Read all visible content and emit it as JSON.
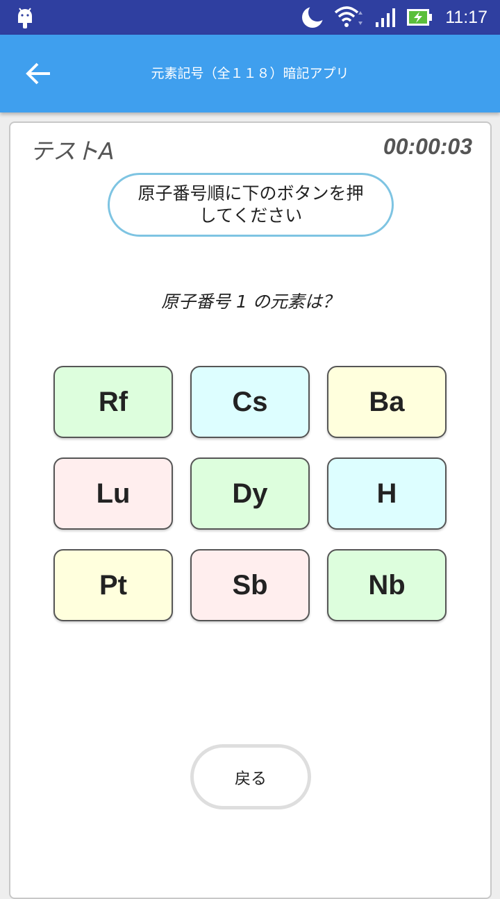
{
  "status_bar": {
    "time": "11:17",
    "icons": [
      "android-icon",
      "moon-icon",
      "wifi-icon",
      "signal-icon",
      "battery-charging-icon"
    ]
  },
  "app_bar": {
    "title": "元素記号（全１１８）暗記アプリ",
    "back_icon": "arrow-left-icon"
  },
  "test": {
    "label": "テストA",
    "timer": "00:00:03",
    "instruction": "原子番号順に下のボタンを押してください",
    "question": "原子番号 1 の元素は？"
  },
  "elements": [
    {
      "symbol": "Rf",
      "color": "#ddfedd"
    },
    {
      "symbol": "Cs",
      "color": "#ddfeff"
    },
    {
      "symbol": "Ba",
      "color": "#ffffdd"
    },
    {
      "symbol": "Lu",
      "color": "#ffeeee"
    },
    {
      "symbol": "Dy",
      "color": "#ddfedd"
    },
    {
      "symbol": "H",
      "color": "#ddfeff"
    },
    {
      "symbol": "Pt",
      "color": "#ffffdd"
    },
    {
      "symbol": "Sb",
      "color": "#ffeeee"
    },
    {
      "symbol": "Nb",
      "color": "#ddfedd"
    }
  ],
  "footer": {
    "back_label": "戻る"
  },
  "colors": {
    "status_bar": "#2f3fa0",
    "app_bar": "#3f9fee",
    "instruction_border": "#7ec4e2"
  }
}
